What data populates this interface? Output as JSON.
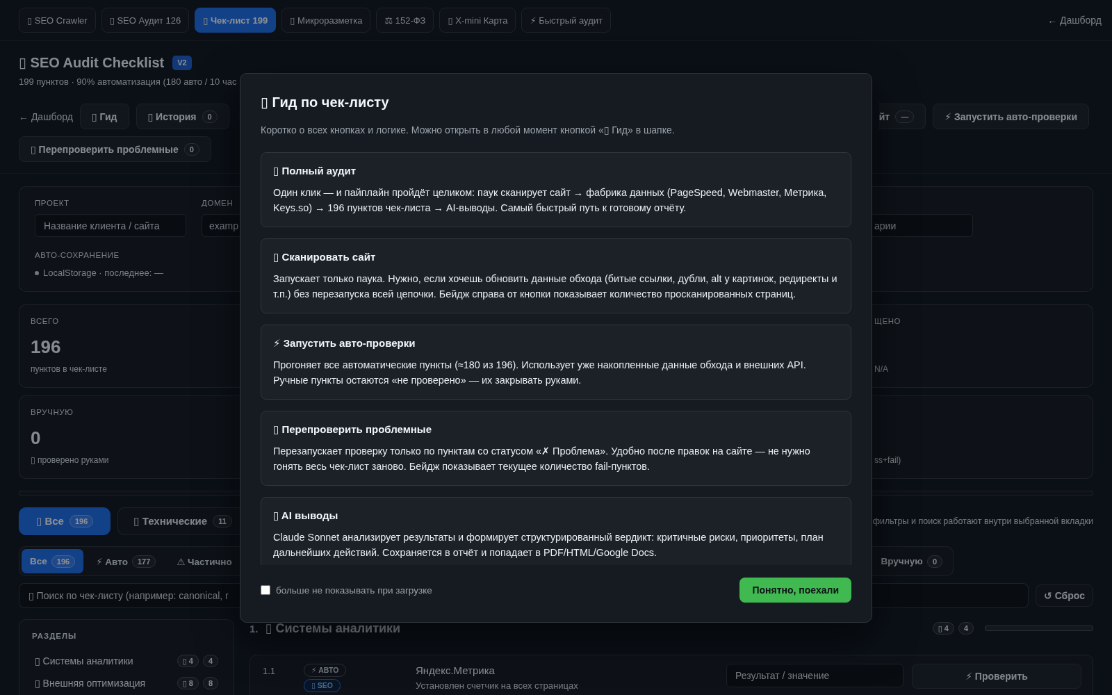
{
  "nav": {
    "tabs": [
      {
        "label": "▯ SEO Crawler",
        "selected": false
      },
      {
        "label": "▯ SEO Аудит 126",
        "selected": false
      },
      {
        "label": "▯ Чек-лист 199",
        "selected": true
      },
      {
        "label": "▯ Микроразметка",
        "selected": false
      },
      {
        "label": "⚖ 152-ФЗ",
        "selected": false
      },
      {
        "label": "▯ X-mini Карта",
        "selected": false
      },
      {
        "label": "⚡ Быстрый аудит",
        "selected": false
      }
    ],
    "dashboard_link": "← Дашборд"
  },
  "header": {
    "title": "▯ SEO Audit Checklist",
    "version_badge": "V2",
    "subtitle": "199 пунктов · 90% автоматизация (180 авто / 10 час"
  },
  "toolbar": {
    "dashboard_link": "← Дашборд",
    "left_buttons": [
      {
        "label": "▯ Гид"
      },
      {
        "label": "▯ История",
        "badge": "0"
      }
    ],
    "right_buttons": [
      {
        "label": "йт",
        "badge": "—"
      },
      {
        "label": "⚡ Запустить авто-проверки"
      }
    ],
    "second_row_buttons": [
      {
        "label": "▯ Перепроверить проблемные",
        "badge": "0"
      }
    ]
  },
  "project": {
    "fields": [
      {
        "label": "ПРОЕКТ",
        "placeholder": "Название клиента / сайта"
      },
      {
        "label": "ДОМЕН",
        "placeholder": "examp"
      }
    ],
    "right_field": {
      "placeholder": "арии"
    },
    "autosave": {
      "label": "АВТО-СОХРАНЕНИЕ",
      "status": "LocalStorage · последнее: —"
    }
  },
  "stats_rows": [
    {
      "left": {
        "label": "ВСЕГО",
        "value": "196",
        "caption": "пунктов в чек-листе"
      },
      "right": {
        "label": "ЩЕНО",
        "caption": "N/A"
      }
    },
    {
      "left": {
        "label": "ВРУЧНУЮ",
        "value": "0",
        "caption": "▯ проверено руками"
      },
      "right": {
        "caption": "ss+fail)"
      }
    }
  ],
  "category_tabs": [
    {
      "label": "▯ Все",
      "count": "196",
      "selected": true
    },
    {
      "label": "▯ Технические",
      "count": "11",
      "selected": false
    }
  ],
  "category_note": "фильтры и поиск работают внутри выбранной вкладки",
  "filters": {
    "left": [
      {
        "label": "Все",
        "count": "196",
        "selected": true
      },
      {
        "label": "⚡ Авто",
        "count": "177",
        "selected": false
      },
      {
        "label": "⚠ Частично",
        "selected": false
      }
    ],
    "right": [
      {
        "label": "Вручную",
        "count": "0",
        "selected": false
      }
    ]
  },
  "search": {
    "placeholder": "▯ Поиск по чек-листу (например: canonical, r",
    "reset_button": "↺ Сброс"
  },
  "sections": {
    "title": "РАЗДЕЛЫ",
    "items": [
      {
        "label": "▯ Системы аналитики",
        "badge": "▯ 4",
        "count": "4"
      },
      {
        "label": "▯ Внешняя оптимизация",
        "badge": "▯ 8",
        "count": "8"
      }
    ]
  },
  "section": {
    "number": "1.",
    "title": "▯ Системы аналитики",
    "badge": "▯ 4",
    "count": "4",
    "level": 0,
    "items": [
      {
        "number": "1.1",
        "tags": [
          {
            "kind": "auto",
            "label": "⚡ АВТО"
          },
          {
            "kind": "seo",
            "label": "▯ SEO"
          }
        ],
        "title": "Яндекс.Метрика",
        "description": "Установлен счетчик на всех страницах",
        "result_placeholder": "Результат / значение",
        "check_button": "⚡ Проверить"
      }
    ]
  },
  "modal": {
    "title": "▯ Гид по чек-листу",
    "intro": "Коротко о всех кнопках и логике. Можно открыть в любой момент кнопкой «▯ Гид» в шапке.",
    "cards": [
      {
        "title": "▯ Полный аудит",
        "text": "Один клик — и пайплайн пройдёт целиком: паук сканирует сайт → фабрика данных (PageSpeed, Webmaster, Метрика, Keys.so) → 196 пунктов чек-листа → AI-выводы. Самый быстрый путь к готовому отчёту."
      },
      {
        "title": "▯ Сканировать сайт",
        "text": "Запускает только паука. Нужно, если хочешь обновить данные обхода (битые ссылки, дубли, alt у картинок, редиректы и т.п.) без перезапуска всей цепочки. Бейдж справа от кнопки показывает количество просканированных страниц."
      },
      {
        "title": "⚡ Запустить авто-проверки",
        "text": "Прогоняет все автоматические пункты (≈180 из 196). Использует уже накопленные данные обхода и внешних API. Ручные пункты остаются «не проверено» — их закрывать руками."
      },
      {
        "title": "▯ Перепроверить проблемные",
        "text": "Перезапускает проверку только по пунктам со статусом «✗ Проблема». Удобно после правок на сайте — не нужно гонять весь чек-лист заново. Бейдж показывает текущее количество fail-пунктов."
      },
      {
        "title": "▯ AI выводы",
        "text": "Claude Sonnet анализирует результаты и формирует структурированный вердикт: критичные риски, приоритеты, план дальнейших действий. Сохраняется в отчёт и попадает в PDF/HTML/Google Docs."
      }
    ],
    "dont_show": {
      "label": "больше не показывать при загрузке",
      "checked": false
    },
    "confirm_button": "Понятно, поехали"
  }
}
